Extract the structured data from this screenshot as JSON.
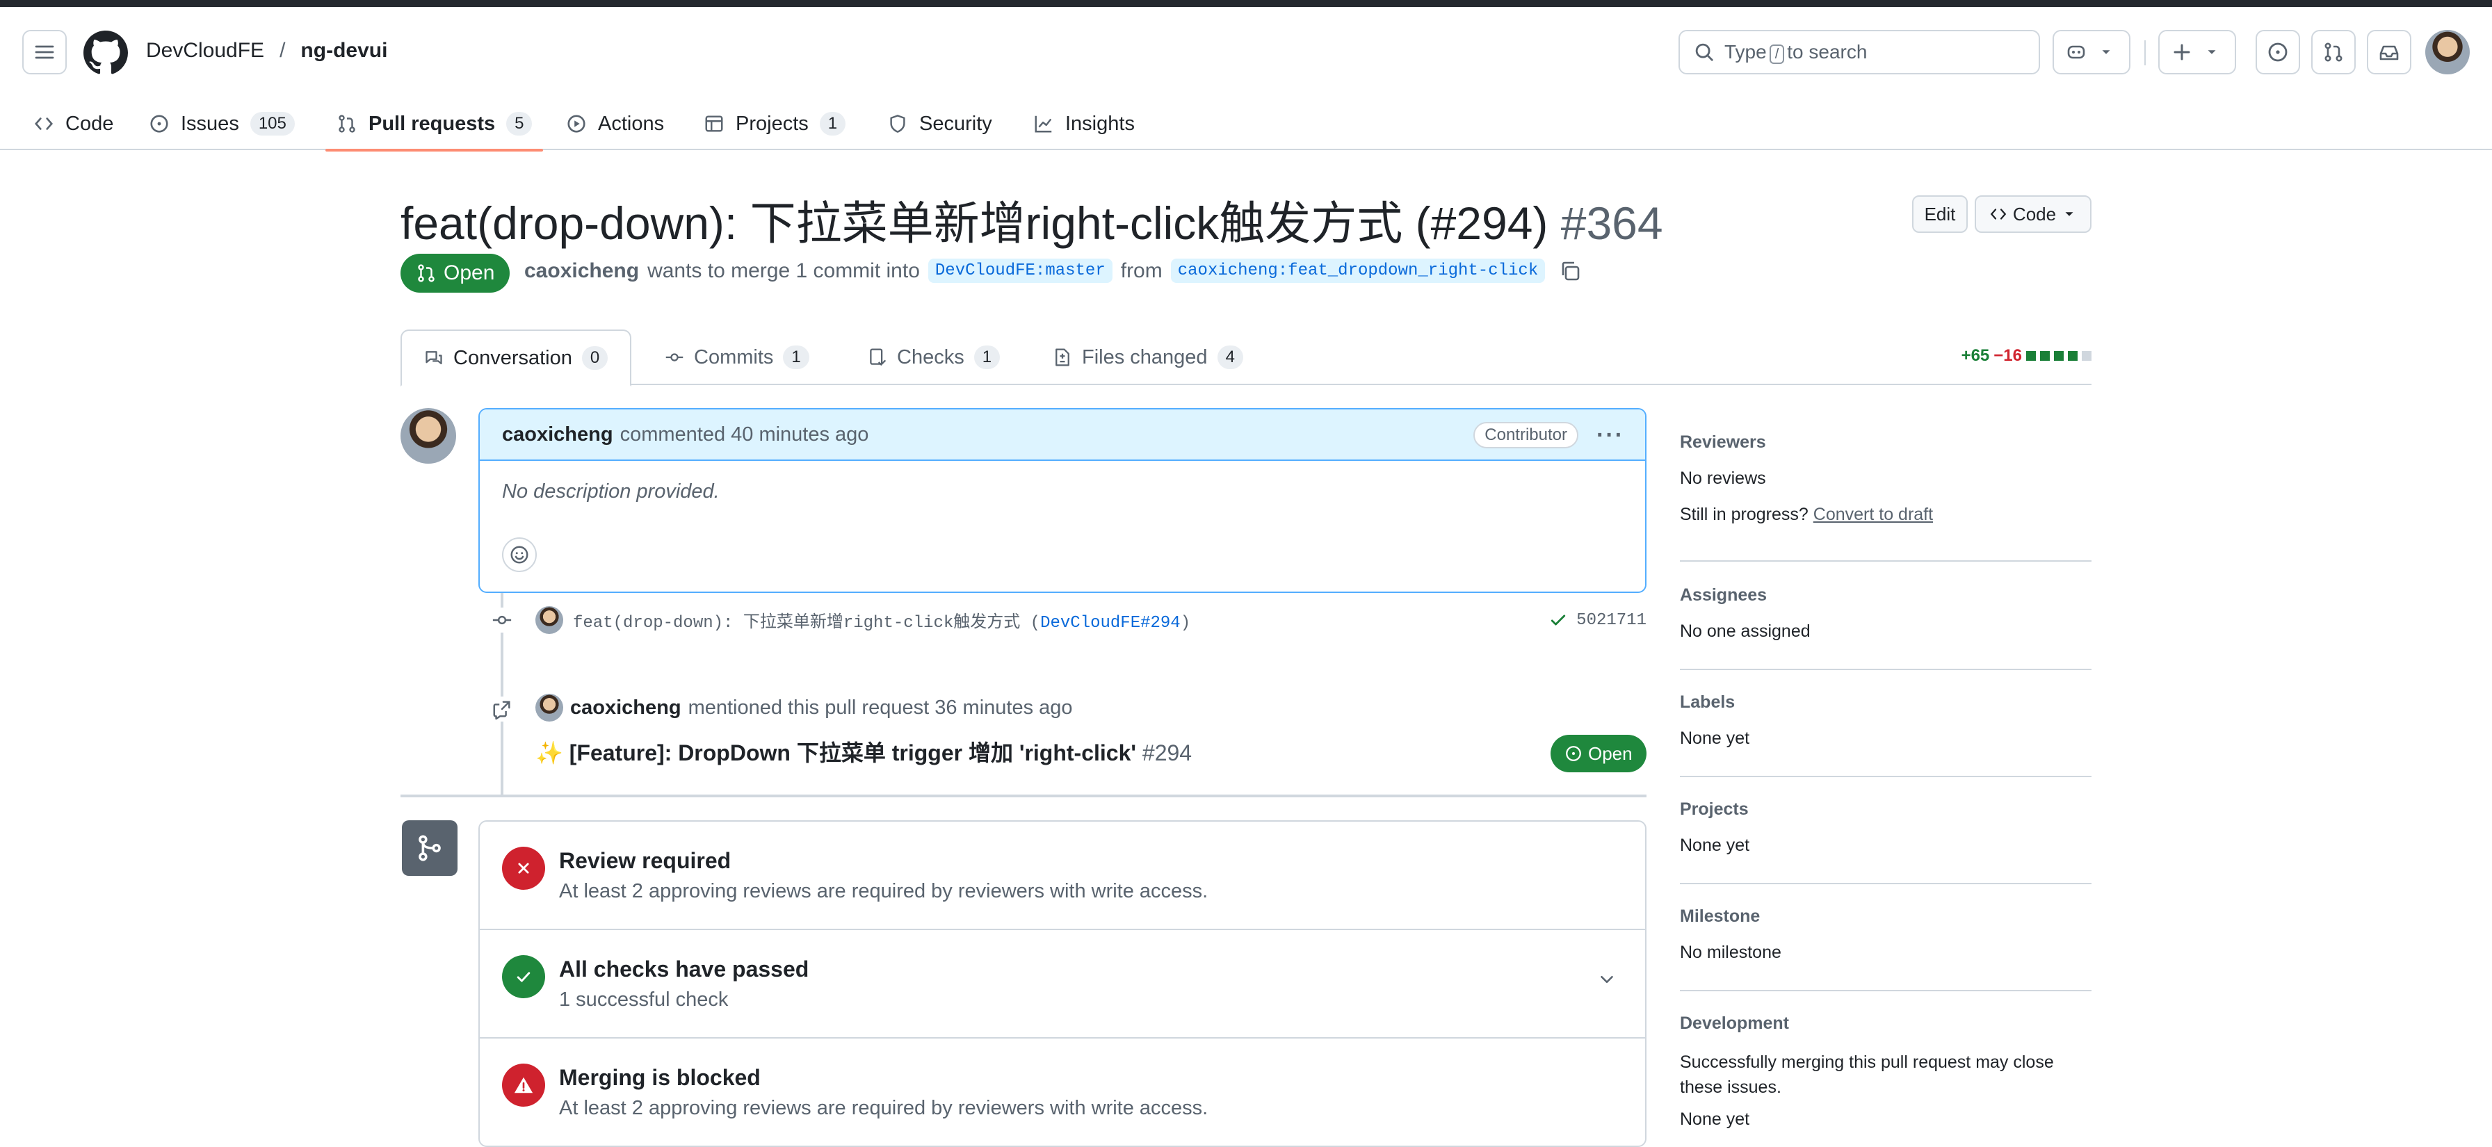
{
  "header": {
    "owner": "DevCloudFE",
    "separator": "/",
    "repo": "ng-devui",
    "search_pre": "Type",
    "search_key": "/",
    "search_post": "to search"
  },
  "repo_nav": {
    "tabs": [
      {
        "label": "Code",
        "icon": "code-icon"
      },
      {
        "label": "Issues",
        "count": "105",
        "icon": "issue-icon"
      },
      {
        "label": "Pull requests",
        "count": "5",
        "icon": "git-pull-request-icon"
      },
      {
        "label": "Actions",
        "icon": "play-icon"
      },
      {
        "label": "Projects",
        "count": "1",
        "icon": "table-icon"
      },
      {
        "label": "Security",
        "icon": "shield-icon"
      },
      {
        "label": "Insights",
        "icon": "graph-icon"
      }
    ]
  },
  "pr": {
    "title": "feat(drop-down): 下拉菜单新增right-click触发方式 (#294)",
    "number": "#364",
    "edit_label": "Edit",
    "code_label": "Code",
    "state": "Open",
    "author": "caoxicheng",
    "meta_text": "wants to merge 1 commit into",
    "base_branch": "DevCloudFE:master",
    "from_text": "from",
    "head_branch": "caoxicheng:feat_dropdown_right-click"
  },
  "pr_tabs": [
    {
      "label": "Conversation",
      "count": "0"
    },
    {
      "label": "Commits",
      "count": "1"
    },
    {
      "label": "Checks",
      "count": "1"
    },
    {
      "label": "Files changed",
      "count": "4"
    }
  ],
  "diffstat": {
    "additions": "+65",
    "deletions": "−16"
  },
  "comment": {
    "author": "caoxicheng",
    "action": "commented 40 minutes ago",
    "role": "Contributor",
    "body": "No description provided."
  },
  "commit": {
    "message": "feat(drop-down): 下拉菜单新增right-click触发方式 (",
    "ref": "DevCloudFE#294",
    "message_end": ")",
    "sha": "5021711"
  },
  "mention": {
    "author": "caoxicheng",
    "text": "mentioned this pull request 36 minutes ago",
    "issue_title": "✨ [Feature]: DropDown 下拉菜单 trigger 增加 'right-click'",
    "issue_number": "#294",
    "state": "Open"
  },
  "merge": {
    "rows": [
      {
        "title": "Review required",
        "desc": "At least 2 approving reviews are required by reviewers with write access."
      },
      {
        "title": "All checks have passed",
        "desc": "1 successful check"
      },
      {
        "title": "Merging is blocked",
        "desc": "At least 2 approving reviews are required by reviewers with write access."
      }
    ]
  },
  "sidebar": {
    "reviewers_h": "Reviewers",
    "reviewers_v": "No reviews",
    "in_progress": "Still in progress?",
    "convert_link": "Convert to draft",
    "assignees_h": "Assignees",
    "assignees_v": "No one assigned",
    "labels_h": "Labels",
    "labels_v": "None yet",
    "projects_h": "Projects",
    "projects_v": "None yet",
    "milestone_h": "Milestone",
    "milestone_v": "No milestone",
    "development_h": "Development",
    "development_text": "Successfully merging this pull request may close these issues.",
    "development_v": "None yet"
  },
  "colors": {
    "accent_green": "#1f883d",
    "danger_red": "#cf222e",
    "link_blue": "#0969da",
    "tab_underline": "#fd8c73"
  }
}
